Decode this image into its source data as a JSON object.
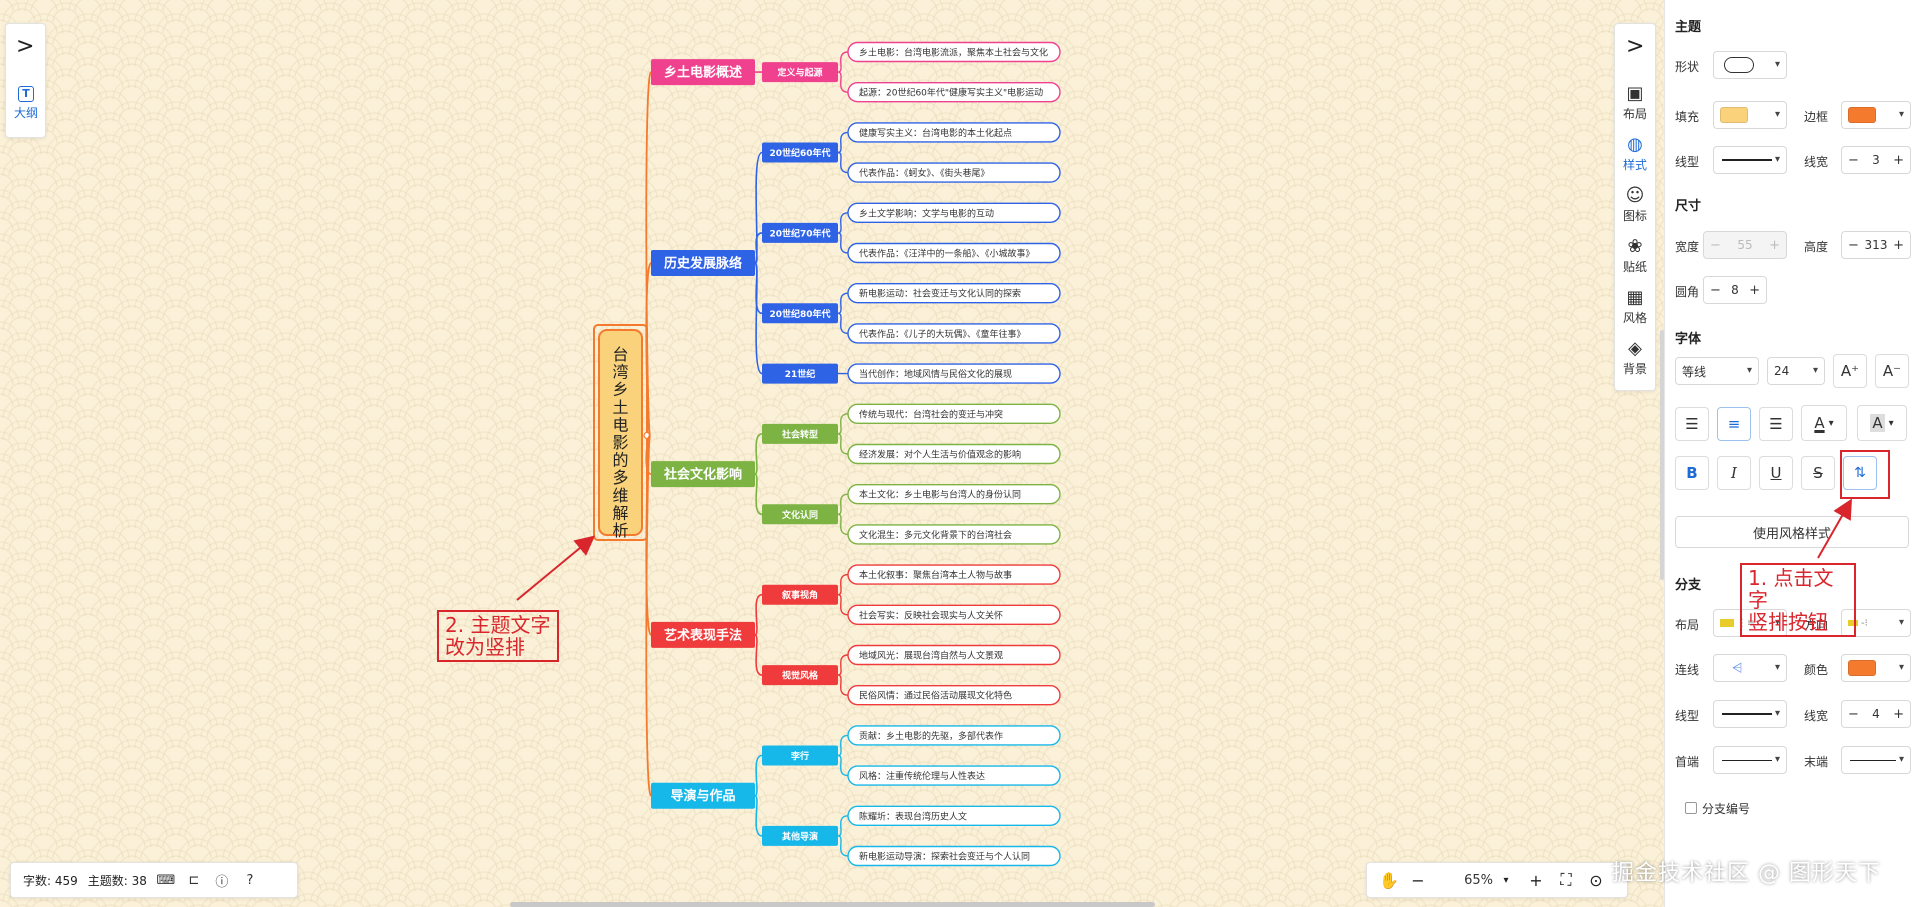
{
  "outline": {
    "toggle": ">",
    "label": "大纲",
    "icon": "T"
  },
  "mindmap": {
    "root": "台湾乡土电影的多维解析",
    "root_fill": "#f9d27b",
    "root_border": "#f47a2e",
    "branches": [
      {
        "label": "乡土电影概述",
        "color": "#f0418f",
        "children": [
          {
            "label": "定义与起源",
            "leaves": [
              "乡土电影：台湾电影流派，聚焦本土社会与文化",
              "起源：20世纪60年代\"健康写实主义\"电影运动"
            ]
          }
        ]
      },
      {
        "label": "历史发展脉络",
        "color": "#2f63e6",
        "children": [
          {
            "label": "20世纪60年代",
            "leaves": [
              "健康写实主义：台湾电影的本土化起点",
              "代表作品：《蚵女》、《街头巷尾》"
            ]
          },
          {
            "label": "20世纪70年代",
            "leaves": [
              "乡土文学影响：文学与电影的互动",
              "代表作品：《汪洋中的一条船》、《小城故事》"
            ]
          },
          {
            "label": "20世纪80年代",
            "leaves": [
              "新电影运动：社会变迁与文化认同的探索",
              "代表作品：《儿子的大玩偶》、《童年往事》"
            ]
          },
          {
            "label": "21世纪",
            "leaves": [
              "当代创作：地域风情与民俗文化的展现"
            ]
          }
        ]
      },
      {
        "label": "社会文化影响",
        "color": "#7cb342",
        "children": [
          {
            "label": "社会转型",
            "leaves": [
              "传统与现代：台湾社会的变迁与冲突",
              "经济发展：对个人生活与价值观念的影响"
            ]
          },
          {
            "label": "文化认同",
            "leaves": [
              "本土文化：乡土电影与台湾人的身份认同",
              "文化混生：多元文化背景下的台湾社会"
            ]
          }
        ]
      },
      {
        "label": "艺术表现手法",
        "color": "#ef3b3b",
        "children": [
          {
            "label": "叙事视角",
            "leaves": [
              "本土化叙事：聚焦台湾本土人物与故事",
              "社会写实：反映社会现实与人文关怀"
            ]
          },
          {
            "label": "视觉风格",
            "leaves": [
              "地域风光：展现台湾自然与人文景观",
              "民俗风情：通过民俗活动展现文化特色"
            ]
          }
        ]
      },
      {
        "label": "导演与作品",
        "color": "#16b8ea",
        "children": [
          {
            "label": "李行",
            "leaves": [
              "贡献：乡土电影的先驱，多部代表作",
              "风格：注重传统伦理与人性表达"
            ]
          },
          {
            "label": "其他导演",
            "leaves": [
              "陈耀圻：表现台湾历史人文",
              "新电影运动导演：探索社会变迁与个人认同"
            ]
          }
        ]
      }
    ]
  },
  "toolbar": {
    "toggle": ">",
    "items": [
      {
        "label": "布局",
        "icon": "▣"
      },
      {
        "label": "样式",
        "icon": "◍"
      },
      {
        "label": "图标",
        "icon": "☺"
      },
      {
        "label": "贴纸",
        "icon": "❀"
      },
      {
        "label": "风格",
        "icon": "▦"
      },
      {
        "label": "背景",
        "icon": "◈"
      }
    ]
  },
  "status": {
    "word_count": "字数: 459",
    "topic_count": "主题数: 38"
  },
  "zoom": {
    "value": "65%",
    "minus": "−",
    "plus": "+"
  },
  "props": {
    "theme_title": "主题",
    "shape_label": "形状",
    "fill_label": "填充",
    "fill_color": "#f9d27b",
    "border_label": "边框",
    "border_color": "#f47a2e",
    "line_type_label": "线型",
    "line_width_label": "线宽",
    "line_width_value": "3",
    "size_title": "尺寸",
    "width_label": "宽度",
    "width_value": "55",
    "height_label": "高度",
    "height_value": "313",
    "radius_label": "圆角",
    "radius_value": "8",
    "font_title": "字体",
    "font_family": "等线",
    "font_size": "24",
    "font_inc": "A⁺",
    "font_dec": "A⁻",
    "style_btn": "使用风格样式",
    "branch_title": "分支",
    "layout_label": "布局",
    "direction_label": "方向",
    "connector_label": "连线",
    "color_label": "颜色",
    "branch_color": "#f47a2e",
    "branch_line_type_label": "线型",
    "branch_line_width_label": "线宽",
    "branch_line_width_value": "4",
    "head_label": "首端",
    "tail_label": "末端",
    "numbering_label": "分支编号"
  },
  "annotations": {
    "step1": "1. 点击文字\n竖排按钮",
    "step2": "2. 主题文字\n改为竖排",
    "color": "#d9262d"
  },
  "watermark": "掘金技术社区 @ 图形天下"
}
